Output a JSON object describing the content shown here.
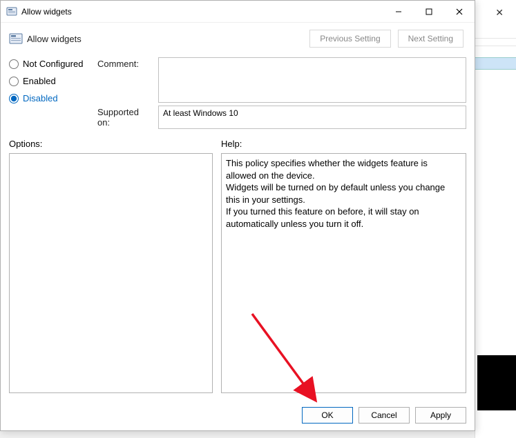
{
  "titlebar": {
    "title": "Allow widgets"
  },
  "header": {
    "title": "Allow widgets",
    "prev_label": "Previous Setting",
    "next_label": "Next Setting"
  },
  "config": {
    "comment_label": "Comment:",
    "comment_value": "",
    "supported_label": "Supported on:",
    "supported_value": "At least Windows 10",
    "radio_not_configured": "Not Configured",
    "radio_enabled": "Enabled",
    "radio_disabled": "Disabled",
    "selected": "disabled"
  },
  "lower": {
    "options_label": "Options:",
    "options_text": "",
    "help_label": "Help:",
    "help_line1": "This policy specifies whether the widgets feature is allowed on the device.",
    "help_line2": "Widgets will be turned on by default unless you change this in your settings.",
    "help_line3": "If you turned this feature on before, it will stay on automatically unless you turn it off."
  },
  "buttons": {
    "ok": "OK",
    "cancel": "Cancel",
    "apply": "Apply"
  },
  "bg": {
    "close_glyph": "✕"
  }
}
